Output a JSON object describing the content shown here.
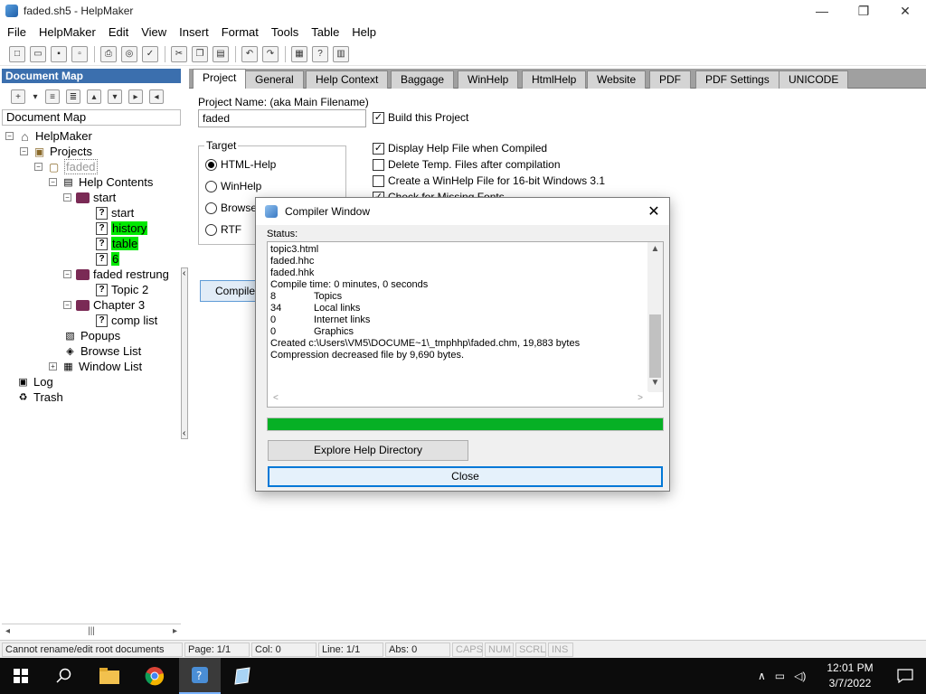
{
  "window": {
    "title": "faded.sh5 - HelpMaker",
    "minimize": "—",
    "maximize": "❐",
    "close": "✕"
  },
  "menu": [
    "File",
    "HelpMaker",
    "Edit",
    "View",
    "Insert",
    "Format",
    "Tools",
    "Table",
    "Help"
  ],
  "docmap": {
    "header": "Document Map",
    "label": "Document Map",
    "tree": {
      "root": "HelpMaker",
      "projects": "Projects",
      "project": "faded",
      "help_contents": "Help Contents",
      "start_book": "start",
      "start_topic": "start",
      "history": "history",
      "table": "table",
      "six": "6",
      "faded_restrung": "faded restrung",
      "topic2": "Topic 2",
      "chapter3": "Chapter 3",
      "comp_list": "comp list",
      "popups": "Popups",
      "browse_list": "Browse List",
      "window_list": "Window List",
      "log": "Log",
      "trash": "Trash"
    }
  },
  "tabs": [
    "Project",
    "General",
    "Help Context",
    "Baggage",
    "WinHelp",
    "HtmlHelp",
    "Website",
    "PDF",
    "PDF Settings",
    "UNICODE"
  ],
  "project": {
    "name_label": "Project Name: (aka Main Filename)",
    "name_value": "faded",
    "build_label": "Build this Project",
    "target_label": "Target",
    "targets": [
      "HTML-Help",
      "WinHelp",
      "Browser",
      "RTF"
    ],
    "options": [
      "Display Help File when Compiled",
      "Delete Temp. Files after compilation",
      "Create a WinHelp File for 16-bit Windows 3.1",
      "Check for Missing Fonts"
    ],
    "compile_label": "Compile"
  },
  "statusbar": {
    "message": "Cannot rename/edit root documents",
    "page": "Page: 1/1",
    "col": "Col: 0",
    "line": "Line: 1/1",
    "abs": "Abs: 0",
    "caps": "CAPS",
    "num": "NUM",
    "scrl": "SCRL",
    "ins": "INS"
  },
  "taskbar": {
    "time": "12:01 PM",
    "date": "3/7/2022"
  },
  "dialog": {
    "title": "Compiler Window",
    "status_label": "Status:",
    "lines": [
      [
        "topic3.html",
        ""
      ],
      [
        "faded.hhc",
        ""
      ],
      [
        "faded.hhk",
        ""
      ],
      [
        "Compile time: 0 minutes, 0 seconds",
        ""
      ],
      [
        "8",
        "Topics"
      ],
      [
        "34",
        "Local links"
      ],
      [
        "0",
        "Internet links"
      ],
      [
        "0",
        "Graphics"
      ],
      [
        "Created c:\\Users\\VM5\\DOCUME~1\\_tmphhp\\faded.chm, 19,883 bytes",
        ""
      ],
      [
        "Compression decreased file by 9,690 bytes.",
        ""
      ]
    ],
    "progress": 1.0,
    "explore_label": "Explore Help Directory",
    "close_label": "Close"
  }
}
